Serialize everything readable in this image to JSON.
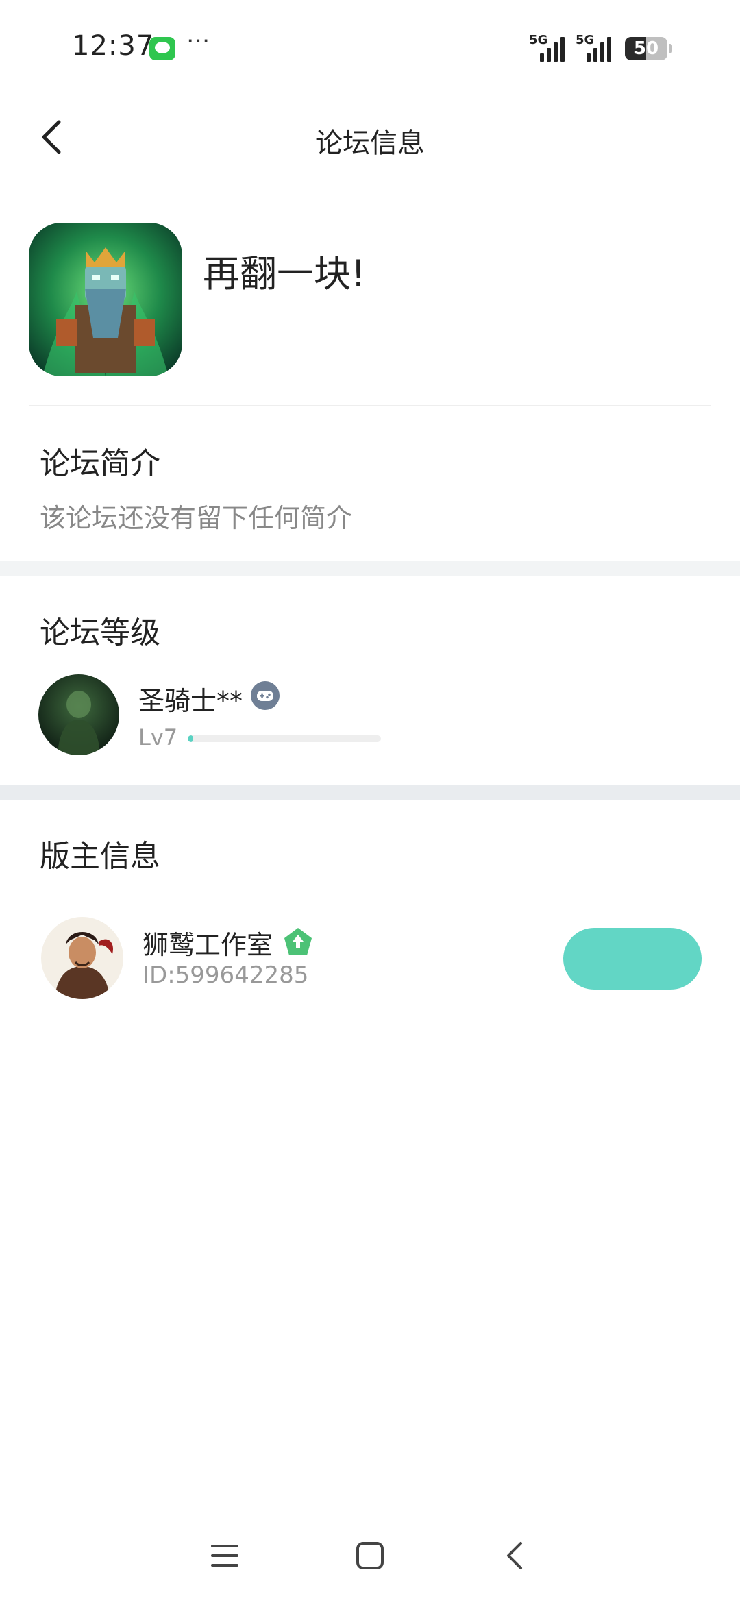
{
  "status_bar": {
    "time": "12:37",
    "dots": "···",
    "network_1": "5G",
    "network_2": "5G",
    "battery": "50",
    "battery_level_percent": 50
  },
  "header": {
    "back_icon": "chevron-left-icon",
    "title": "论坛信息"
  },
  "forum": {
    "name": "再翻一块!"
  },
  "intro": {
    "title": "论坛简介",
    "text": "该论坛还没有留下任何简介"
  },
  "level": {
    "title": "论坛等级",
    "user_name": "圣骑士**",
    "role_icon": "gamepad-icon",
    "level": "Lv7",
    "progress_fraction": 0.03
  },
  "moderator": {
    "title": "版主信息",
    "name": "狮鹫工作室",
    "badge_icon": "moderator-badge-icon",
    "id": "ID:599642285"
  },
  "colors": {
    "accent": "#62d6c5",
    "section_gap": "#f2f4f5",
    "badge_green": "#4cc276"
  },
  "system_nav": {
    "icons": [
      "menu-icon",
      "home-square-icon",
      "back-icon"
    ]
  }
}
